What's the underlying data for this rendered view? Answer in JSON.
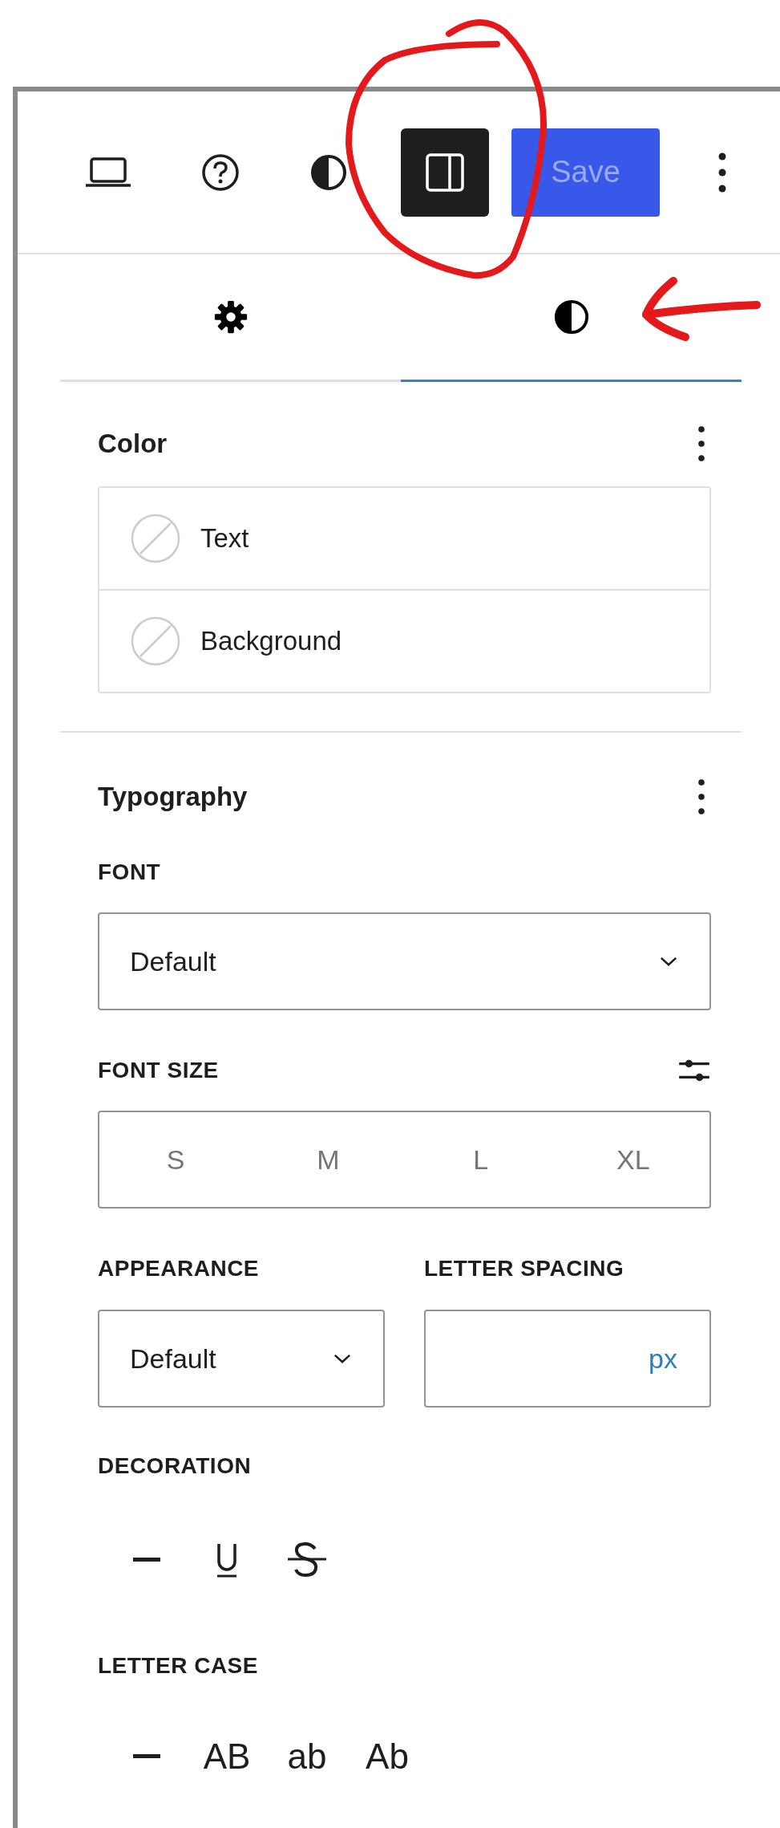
{
  "toolbar": {
    "sidebar_toggle": {
      "pressed": true
    },
    "save_button": {
      "label": "Save",
      "disabled": true
    }
  },
  "tabs": [
    {
      "kind": "settings",
      "selected": false
    },
    {
      "kind": "styles",
      "selected": true
    }
  ],
  "color": {
    "title": "Color",
    "items": [
      {
        "label": "Text"
      },
      {
        "label": "Background"
      }
    ]
  },
  "typography": {
    "title": "Typography",
    "font": {
      "label": "FONT",
      "value": "Default"
    },
    "font_size": {
      "label": "FONT SIZE",
      "options": [
        {
          "label": "S",
          "selected": false
        },
        {
          "label": "M",
          "selected": false
        },
        {
          "label": "L",
          "selected": false
        },
        {
          "label": "XL",
          "selected": false
        }
      ]
    },
    "appearance": {
      "label": "APPEARANCE",
      "value": "Default"
    },
    "letter_spacing": {
      "label": "LETTER SPACING",
      "unit": "px"
    },
    "decoration": {
      "label": "DECORATION",
      "options": [
        {
          "kind": "none",
          "selected": false
        },
        {
          "kind": "underline",
          "selected": false
        },
        {
          "kind": "strikethrough",
          "selected": false
        }
      ]
    },
    "letter_case": {
      "label": "LETTER CASE",
      "options": [
        {
          "kind": "none",
          "selected": false
        },
        {
          "kind": "text",
          "label": "AB",
          "selected": false
        },
        {
          "kind": "text",
          "label": "ab",
          "selected": false
        },
        {
          "kind": "text",
          "label": "Ab",
          "selected": false
        }
      ]
    }
  },
  "annotations": {
    "circle": true,
    "arrow": true
  }
}
